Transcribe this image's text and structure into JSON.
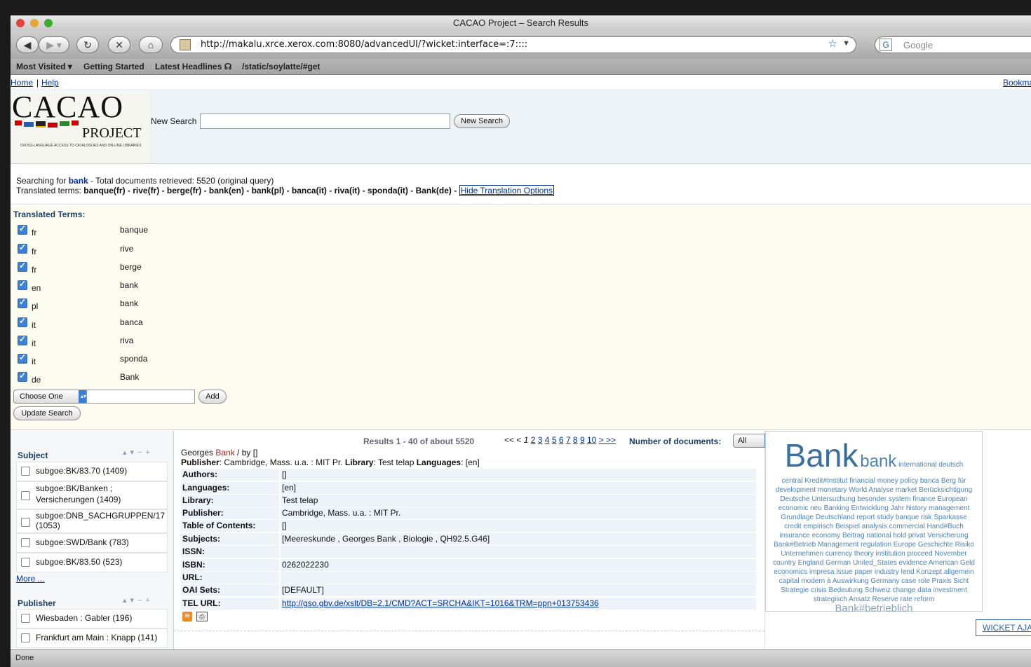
{
  "browser": {
    "window_title": "CACAO Project – Search Results",
    "url": "http://makalu.xrce.xerox.com:8080/advancedUI/?wicket:interface=:7::::",
    "search_placeholder": "Google",
    "bookmarks": [
      "Most Visited ▾",
      "Getting Started",
      "Latest Headlines ☊",
      "/static/soylatte/#get"
    ],
    "status": "Done"
  },
  "topnav": {
    "home": "Home",
    "help": "Help",
    "bookmark": "Bookma"
  },
  "header": {
    "logo_title": "CACAO",
    "logo_sub": "PROJECT",
    "logo_tagline": "CROSS-LANGUAGE ACCESS TO CATALOGUES AND ON-LINE LIBRARIES",
    "new_search_label": "New Search",
    "new_search_button": "New Search"
  },
  "search_info": {
    "prefix": "Searching for ",
    "term": "bank",
    "summary": " - Total documents retrieved: 5520 (original query)",
    "translated_prefix": "Translated terms: ",
    "translated_terms": "banque(fr) - rive(fr) - berge(fr) - bank(en) - bank(pl) - banca(it) - riva(it) - sponda(it) - Bank(de) -",
    "hide_link": "Hide Translation Options"
  },
  "translation": {
    "title": "Translated Terms:",
    "terms": [
      {
        "lang": "fr",
        "term": "banque"
      },
      {
        "lang": "fr",
        "term": "rive"
      },
      {
        "lang": "fr",
        "term": "berge"
      },
      {
        "lang": "en",
        "term": "bank"
      },
      {
        "lang": "pl",
        "term": "bank"
      },
      {
        "lang": "it",
        "term": "banca"
      },
      {
        "lang": "it",
        "term": "riva"
      },
      {
        "lang": "it",
        "term": "sponda"
      },
      {
        "lang": "de",
        "term": "Bank"
      }
    ],
    "choose_one": "Choose One",
    "add_button": "Add",
    "update_button": "Update Search"
  },
  "facets": {
    "subject_title": "Subject",
    "subject_items": [
      "subgoe:BK/83.70 (1409)",
      "subgoe:BK/Banken ;",
      "Versicherungen (1409)",
      "subgoe:DNB_SACHGRUPPEN/17",
      "(1053)",
      "subgoe:SWD/Bank (783)",
      "subgoe:BK/83.50 (523)"
    ],
    "more": "More ...",
    "publisher_title": "Publisher",
    "publisher_items": [
      "Wiesbaden : Gabler (196)",
      "Frankfurt am Main : Knapp (141)"
    ]
  },
  "results": {
    "summary": "Results 1 - 40 of about 5520",
    "pager_prev": "<< <",
    "current_page": "1",
    "pages": [
      "2",
      "3",
      "4",
      "5",
      "6",
      "7",
      "8",
      "9",
      "10"
    ],
    "pager_next": "> >>",
    "num_docs_label": "Number of documents:",
    "num_docs_value": "All",
    "record_author": "Georges ",
    "record_hit": "Bank",
    "record_by": " / by []",
    "publisher_label": "Publisher",
    "publisher_value": ": Cambridge, Mass. u.a. : MIT Pr. ",
    "library_label": "Library",
    "library_value": ": Test telap ",
    "languages_label": "Languages",
    "languages_value": ": [en]",
    "details": [
      {
        "label": "Authors:",
        "value": "[]"
      },
      {
        "label": "Languages:",
        "value": "[en]"
      },
      {
        "label": "Library:",
        "value": "Test telap"
      },
      {
        "label": "Publisher:",
        "value": "Cambridge, Mass. u.a. : MIT Pr."
      },
      {
        "label": "Table of Contents:",
        "value": "[]"
      },
      {
        "label": "Subjects:",
        "value": "[Meereskunde , Georges Bank , Biologie , QH92.5.G46]"
      },
      {
        "label": "ISSN:",
        "value": ""
      },
      {
        "label": "ISBN:",
        "value": "0262022230"
      },
      {
        "label": "URL:",
        "value": ""
      },
      {
        "label": "OAI Sets:",
        "value": "[DEFAULT]"
      },
      {
        "label": "TEL URL:",
        "value": "http://gso.gbv.de/xslt/DB=2.1/CMD?ACT=SRCHA&IKT=1016&TRM=ppn+013753436"
      }
    ]
  },
  "cloud": {
    "big": "Bank",
    "medium": "bank",
    "small_first": "international deutsch",
    "text": "central Kredit#Institut financial money policy banca Berg für development monetary World Analyse market Berücksichtigung Deutsche Untersuchung besonder system finance European economic neu Banking Entwicklung Jahr history management Grundlage Deutschland report study banque risk Sparkasse credit empirisch Beispiel analysis commercial Hand#Buch insurance economy Beitrag national hold privat Versicherung Bank#Betrieb Management regulation Europe Geschichte Risiko Unternehmen currency theory institution proceed November country England German United_States evidence American Geld economics impresa issue paper industry lend Konzept allgemein capital modern à Auswirkung Germany case role Praxis Sicht Strategie crisis Bedeutung Schweiz change data investment strategisch Ansatz Reserve rate reform",
    "last_large": "Bank#betrieblich",
    "wicket": "WICKET AJA"
  },
  "colors": {
    "link": "#003399",
    "accent": "#1c3e63",
    "cloud": "#4c83b5"
  }
}
